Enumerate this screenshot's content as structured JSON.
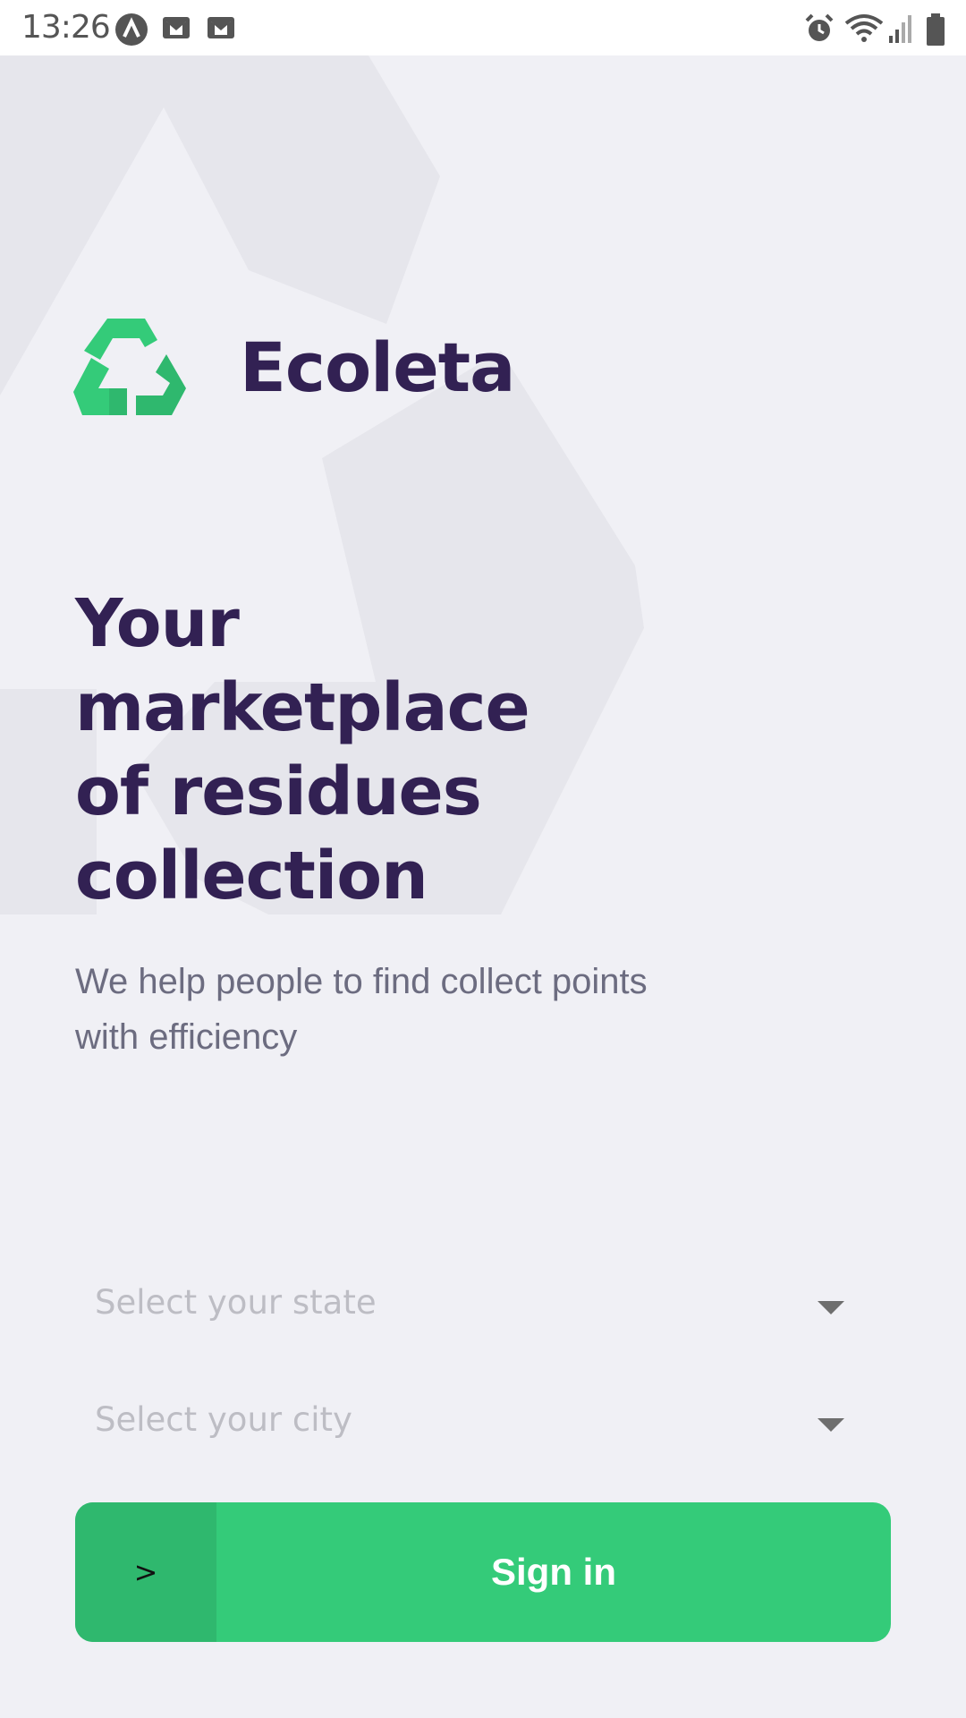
{
  "status_bar": {
    "time": "13:26",
    "left_icons": [
      "app-notification-icon",
      "gmail-icon",
      "gmail-icon"
    ],
    "right_icons": [
      "alarm-icon",
      "wifi-icon",
      "signal-icon",
      "battery-icon"
    ]
  },
  "brand": {
    "name": "Ecoleta",
    "logo_icon": "recycle-icon",
    "logo_color": "#34CB79"
  },
  "hero": {
    "title_lines": [
      "Your",
      "marketplace",
      "of residues",
      "collection"
    ],
    "description": "We help people to find collect points with efficiency"
  },
  "form": {
    "state_placeholder": "Select your state",
    "city_placeholder": "Select your city"
  },
  "signin": {
    "label": "Sign in",
    "icon_text": ">"
  },
  "colors": {
    "background": "#F0F0F5",
    "title": "#322153",
    "text": "#6C6C80",
    "primary": "#34CB79",
    "primary_dark": "#2FB86E"
  }
}
